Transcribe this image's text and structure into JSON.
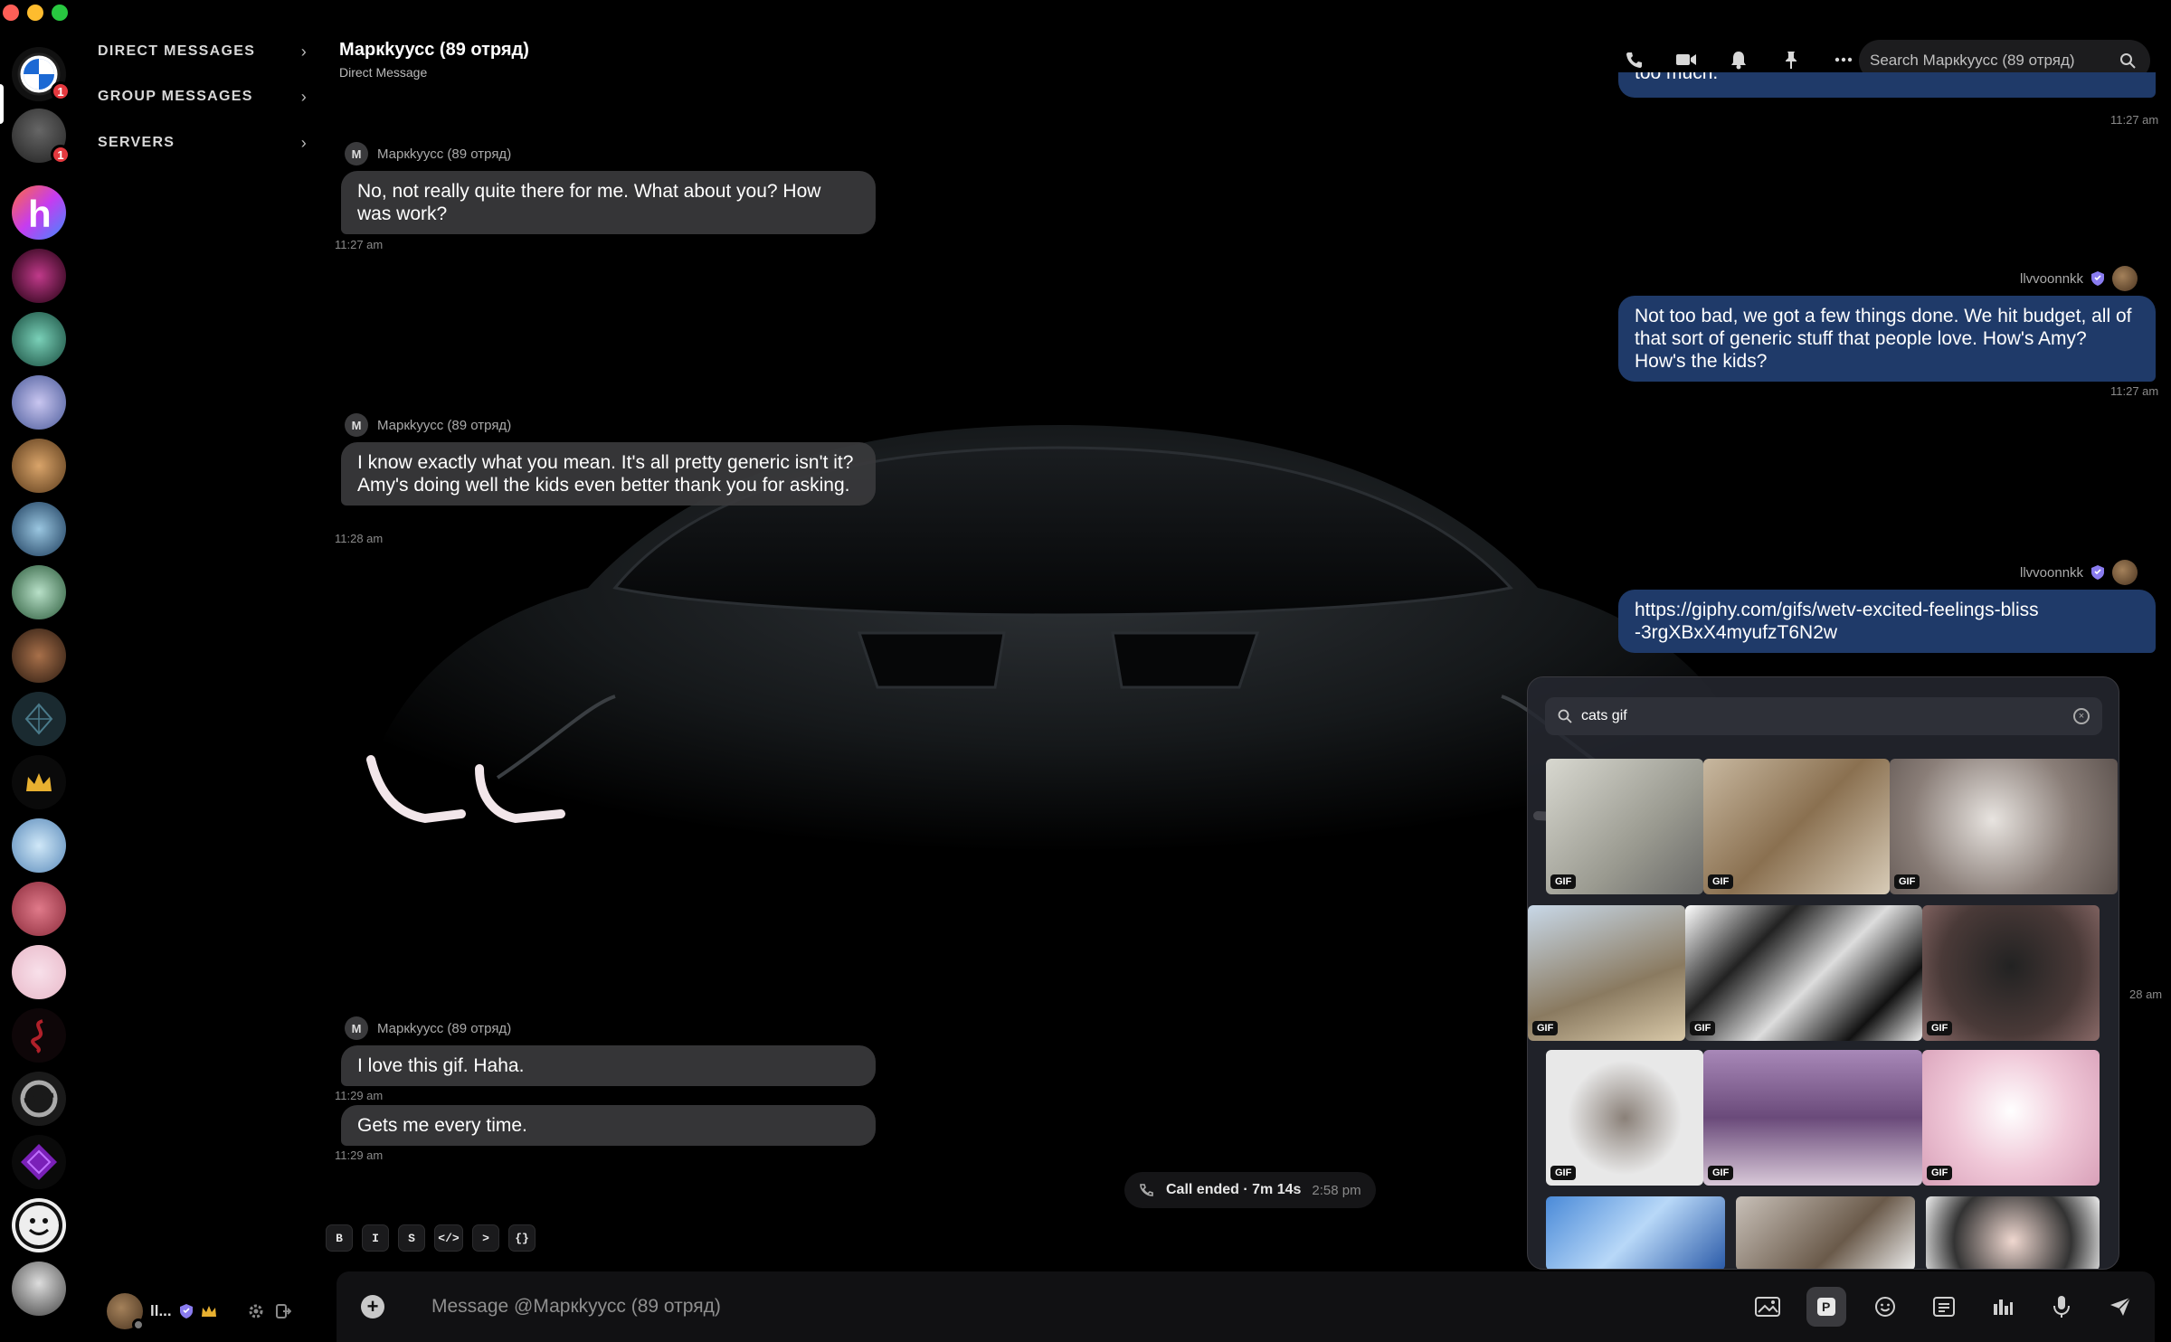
{
  "nav": {
    "direct_messages": "DIRECT MESSAGES",
    "group_messages": "GROUP MESSAGES",
    "servers": "SERVERS"
  },
  "rail": {
    "badges": [
      "1",
      "1"
    ]
  },
  "user": {
    "name": "ll..."
  },
  "header": {
    "title": "Маркkуусс (89 отряд)",
    "subtitle": "Direct Message",
    "search_placeholder": "Search Маркkуусс (89 отряд)"
  },
  "messages": [
    {
      "author": "Маркkуусс (89 отряд)",
      "avatar": "M",
      "text": "No, not really quite there for me. What about you? How was work?",
      "time": "11:27 am"
    },
    {
      "author": "llvvoonnkk",
      "text": "Not too bad, we got a few things done. We hit budget, all of that sort of generic stuff that people love. How's Amy? How's the kids?",
      "time": "11:27 am"
    },
    {
      "author": "Маркkуусс (89 отряд)",
      "avatar": "M",
      "text": "I know exactly what you mean. It's all pretty generic isn't it? Amy's doing well the kids even better thank you for asking.",
      "time": "11:28 am"
    },
    {
      "author": "llvvoonnkk",
      "text": "https://giphy.com/gifs/wetv-excited-feelings-bliss-3rgXBxX4myufzT6N2w",
      "time": ""
    },
    {
      "author": "Маркkуусс (89 отряд)",
      "avatar": "M",
      "text": "I love this gif. Haha.",
      "time": "11:29 am"
    },
    {
      "author": "",
      "text": "Gets me every time.",
      "time": "11:29 am"
    }
  ],
  "top_partial": {
    "text": "too much.",
    "time": "11:27 am"
  },
  "right_partial_time": "28 am",
  "call": {
    "label": "Call ended · 7m 14s",
    "time": "2:58 pm"
  },
  "format_buttons": [
    "B",
    "I",
    "S",
    "</>",
    ">",
    "{}"
  ],
  "composer": {
    "placeholder": "Message @Маркkуусс (89 отряд)"
  },
  "gif_picker": {
    "query": "cats gif",
    "tag": "GIF"
  },
  "colors": {
    "accent_out": "#1f3a69",
    "bubble_in": "#3a3a3c",
    "badge": "#e5393f"
  }
}
